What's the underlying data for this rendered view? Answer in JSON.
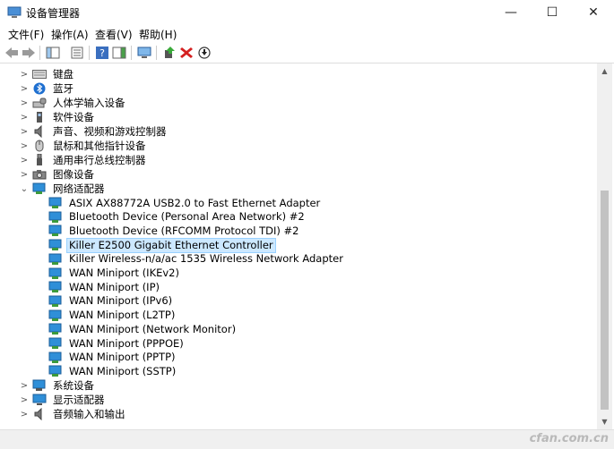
{
  "window": {
    "title": "设备管理器",
    "minimize": "—",
    "maximize": "☐",
    "close": "✕"
  },
  "menu": [
    {
      "label": "文件(F)"
    },
    {
      "label": "操作(A)"
    },
    {
      "label": "查看(V)"
    },
    {
      "label": "帮助(H)"
    }
  ],
  "tree": {
    "categories_top": [
      {
        "label": "键盘",
        "icon": "keyboard-icon"
      },
      {
        "label": "蓝牙",
        "icon": "bluetooth-icon"
      },
      {
        "label": "人体学输入设备",
        "icon": "hid-icon"
      },
      {
        "label": "软件设备",
        "icon": "software-device-icon"
      },
      {
        "label": "声音、视频和游戏控制器",
        "icon": "speaker-icon"
      },
      {
        "label": "鼠标和其他指针设备",
        "icon": "mouse-icon"
      },
      {
        "label": "通用串行总线控制器",
        "icon": "usb-icon"
      },
      {
        "label": "图像设备",
        "icon": "camera-icon"
      }
    ],
    "network_category": {
      "label": "网络适配器",
      "icon": "network-adapter-icon",
      "expanded": true
    },
    "network_adapters": [
      {
        "label": "ASIX AX88772A USB2.0 to Fast Ethernet Adapter"
      },
      {
        "label": "Bluetooth Device (Personal Area Network) #2"
      },
      {
        "label": "Bluetooth Device (RFCOMM Protocol TDI) #2"
      },
      {
        "label": "Killer E2500 Gigabit Ethernet Controller",
        "selected": true
      },
      {
        "label": "Killer Wireless-n/a/ac 1535 Wireless Network Adapter"
      },
      {
        "label": "WAN Miniport (IKEv2)"
      },
      {
        "label": "WAN Miniport (IP)"
      },
      {
        "label": "WAN Miniport (IPv6)"
      },
      {
        "label": "WAN Miniport (L2TP)"
      },
      {
        "label": "WAN Miniport (Network Monitor)"
      },
      {
        "label": "WAN Miniport (PPPOE)"
      },
      {
        "label": "WAN Miniport (PPTP)"
      },
      {
        "label": "WAN Miniport (SSTP)"
      }
    ],
    "categories_bottom": [
      {
        "label": "系统设备",
        "icon": "system-device-icon"
      },
      {
        "label": "显示适配器",
        "icon": "display-adapter-icon"
      },
      {
        "label": "音频输入和输出",
        "icon": "audio-io-icon"
      }
    ]
  },
  "watermark": "cfan.com.cn",
  "colors": {
    "selection": "#cce8ff",
    "network_icon": "#2f8fd8"
  }
}
